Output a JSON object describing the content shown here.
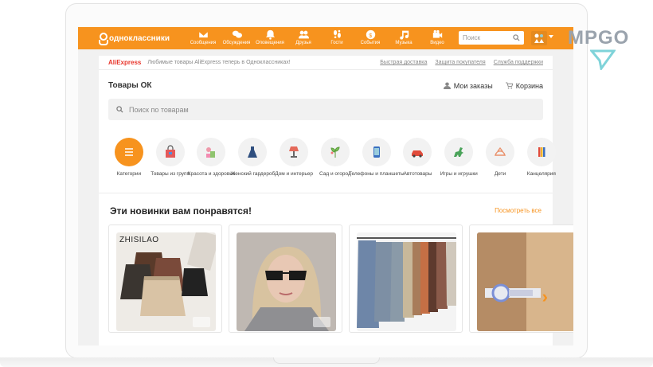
{
  "brand": {
    "name": "одноклассники"
  },
  "nav": [
    {
      "label": "Сообщения",
      "icon": "envelope-icon"
    },
    {
      "label": "Обсуждения",
      "icon": "chat-icon"
    },
    {
      "label": "Оповещения",
      "icon": "bell-icon"
    },
    {
      "label": "Друзья",
      "icon": "friends-icon"
    },
    {
      "label": "Гости",
      "icon": "footprints-icon"
    },
    {
      "label": "События",
      "icon": "events-icon"
    },
    {
      "label": "Музыка",
      "icon": "music-icon"
    },
    {
      "label": "Видео",
      "icon": "video-icon"
    }
  ],
  "search": {
    "placeholder": "Поиск"
  },
  "ali_bar": {
    "logo": "AliExpress",
    "text": "Любимые товары AliExpress теперь в Одноклассниках!",
    "links": [
      "Быстрая доставка",
      "Защита покупателя",
      "Служба поддержки"
    ]
  },
  "header": {
    "title": "Товары ОК",
    "orders": "Мои заказы",
    "cart": "Корзина"
  },
  "product_search": {
    "placeholder": "Поиск по товарам"
  },
  "categories": [
    {
      "label": "Категории",
      "icon": "menu-icon"
    },
    {
      "label": "Товары из групп",
      "icon": "shopping-bag-icon"
    },
    {
      "label": "Красота и здоровье",
      "icon": "beauty-icon"
    },
    {
      "label": "Женский гардероб",
      "icon": "dress-icon"
    },
    {
      "label": "Дом и интерьер",
      "icon": "lamp-icon"
    },
    {
      "label": "Сад и огород",
      "icon": "plant-icon"
    },
    {
      "label": "Телефоны и планшеты",
      "icon": "phone-icon"
    },
    {
      "label": "Автотовары",
      "icon": "car-icon"
    },
    {
      "label": "Игры и игрушки",
      "icon": "dinosaur-icon"
    },
    {
      "label": "Дети",
      "icon": "baby-icon"
    },
    {
      "label": "Канцелярия",
      "icon": "pencils-icon"
    }
  ],
  "section": {
    "title": "Эти новинки вам понравятся!",
    "more": "Посмотреть все"
  },
  "cards": [
    {
      "brand": "ZHISILAO",
      "image": "skirts-photo"
    },
    {
      "brand": "",
      "image": "woman-sunglasses-photo"
    },
    {
      "brand": "",
      "image": "pleated-skirts-photo"
    },
    {
      "brand": "",
      "image": "child-lock-photo"
    }
  ],
  "watermark": "MPGO",
  "colors": {
    "accent": "#f7931e",
    "ali_red": "#e8352b"
  }
}
